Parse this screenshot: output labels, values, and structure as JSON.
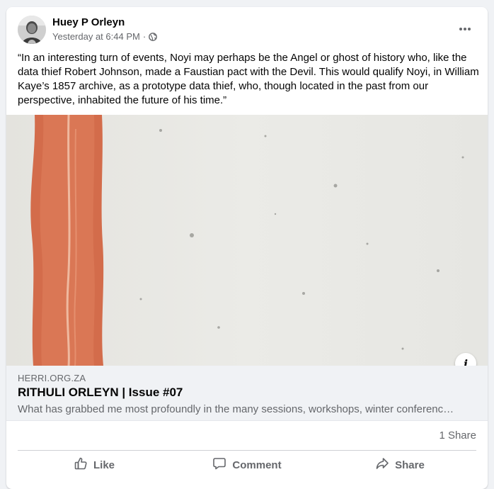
{
  "post": {
    "author": "Huey P Orleyn",
    "timestamp": "Yesterday at 6:44 PM",
    "separator": "·",
    "audience_icon": "globe-icon",
    "more_icon": "more-options-icon",
    "text": "“In an interesting turn of events, Noyi may perhaps be the Angel or ghost of history who, like the data thief Robert Johnson, made a Faustian pact with the Devil. This would qualify Noyi, in William Kaye’s 1857 archive, as a prototype data thief, who, though located in the past from our perspective, inhabited the future of his time.”"
  },
  "link": {
    "domain": "HERRI.ORG.ZA",
    "title": "RITHULI ORLEYN | Issue #07",
    "description": "What has grabbed me most profoundly in the many sessions, workshops, winter conferenc…",
    "info_label": "i"
  },
  "engagement": {
    "shares": "1 Share"
  },
  "actions": {
    "like": "Like",
    "comment": "Comment",
    "share": "Share"
  },
  "colors": {
    "background": "#f0f2f5",
    "card": "#ffffff",
    "secondary_text": "#65676b",
    "image_stripe": "#d6704f",
    "image_background": "#e9e8e3"
  }
}
